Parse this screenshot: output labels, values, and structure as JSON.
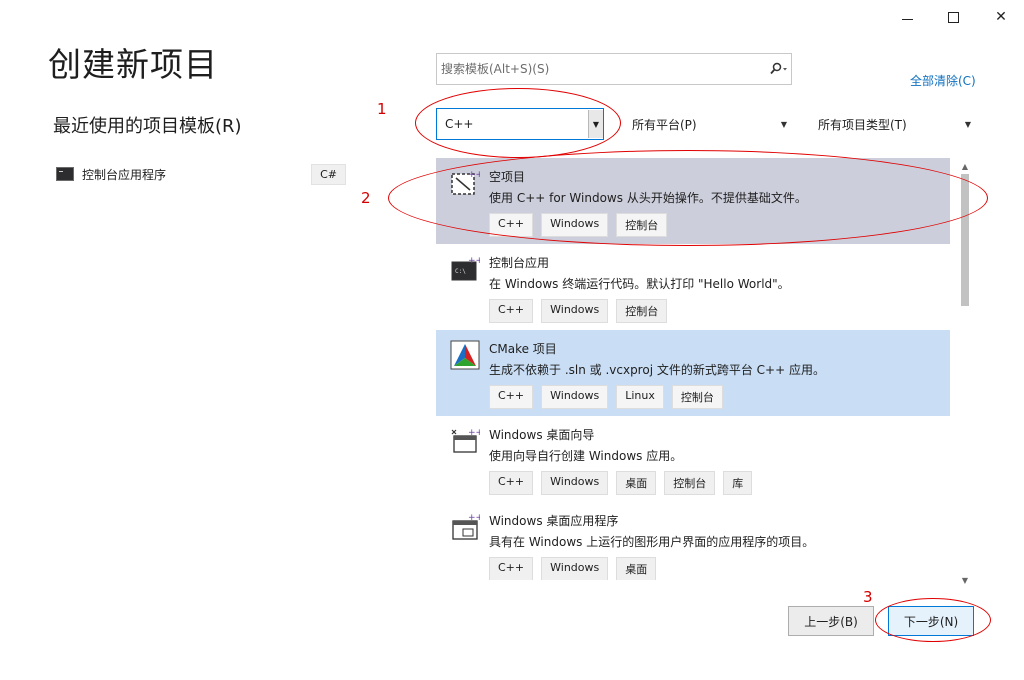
{
  "window": {
    "minimize": "—",
    "maximize": "☐",
    "close": "✕"
  },
  "page_title": "创建新项目",
  "recent": {
    "title": "最近使用的项目模板(R)",
    "items": [
      {
        "label": "控制台应用程序",
        "lang": "C#"
      }
    ]
  },
  "search": {
    "placeholder": "搜索模板(Alt+S)(S)",
    "icon": "search-icon"
  },
  "clear_all": "全部清除(C)",
  "filters": {
    "language": "C++",
    "platform": "所有平台(P)",
    "type": "所有项目类型(T)"
  },
  "templates": [
    {
      "name": "空项目",
      "desc": "使用 C++ for Windows 从头开始操作。不提供基础文件。",
      "tags": [
        "C++",
        "Windows",
        "控制台"
      ]
    },
    {
      "name": "控制台应用",
      "desc": "在 Windows 终端运行代码。默认打印 \"Hello World\"。",
      "tags": [
        "C++",
        "Windows",
        "控制台"
      ]
    },
    {
      "name": "CMake 项目",
      "desc": "生成不依赖于 .sln 或 .vcxproj 文件的新式跨平台 C++ 应用。",
      "tags": [
        "C++",
        "Windows",
        "Linux",
        "控制台"
      ]
    },
    {
      "name": "Windows 桌面向导",
      "desc": "使用向导自行创建 Windows 应用。",
      "tags": [
        "C++",
        "Windows",
        "桌面",
        "控制台",
        "库"
      ]
    },
    {
      "name": "Windows 桌面应用程序",
      "desc": "具有在 Windows 上运行的图形用户界面的应用程序的项目。",
      "tags": [
        "C++",
        "Windows",
        "桌面"
      ]
    }
  ],
  "buttons": {
    "prev": "上一步(B)",
    "next": "下一步(N)"
  },
  "annotations": [
    "1",
    "2",
    "3"
  ],
  "colors": {
    "accent": "#0078d7",
    "selected": "#cccedb",
    "hover": "#c9def5",
    "annotation": "#e00000"
  }
}
